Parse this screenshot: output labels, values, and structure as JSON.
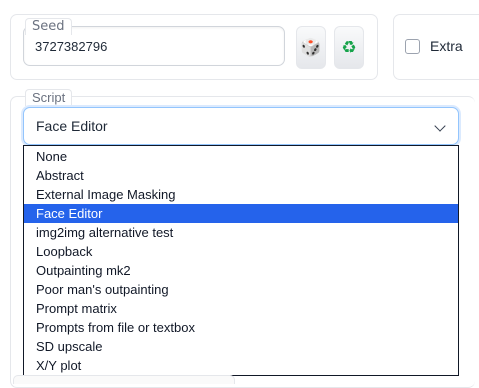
{
  "seed": {
    "label": "Seed",
    "value": "3727382796",
    "dice_icon": "dice-icon",
    "recycle_icon": "recycle-icon"
  },
  "extra": {
    "label": "Extra",
    "checked": false
  },
  "script": {
    "label": "Script",
    "selected": "Face Editor",
    "options": [
      "None",
      "Abstract",
      "External Image Masking",
      "Face Editor",
      "img2img alternative test",
      "Loopback",
      "Outpainting mk2",
      "Poor man's outpainting",
      "Prompt matrix",
      "Prompts from file or textbox",
      "SD upscale",
      "X/Y plot"
    ],
    "highlighted_index": 3
  },
  "colors": {
    "highlight": "#2563eb",
    "focus_border": "#93c5fd"
  }
}
